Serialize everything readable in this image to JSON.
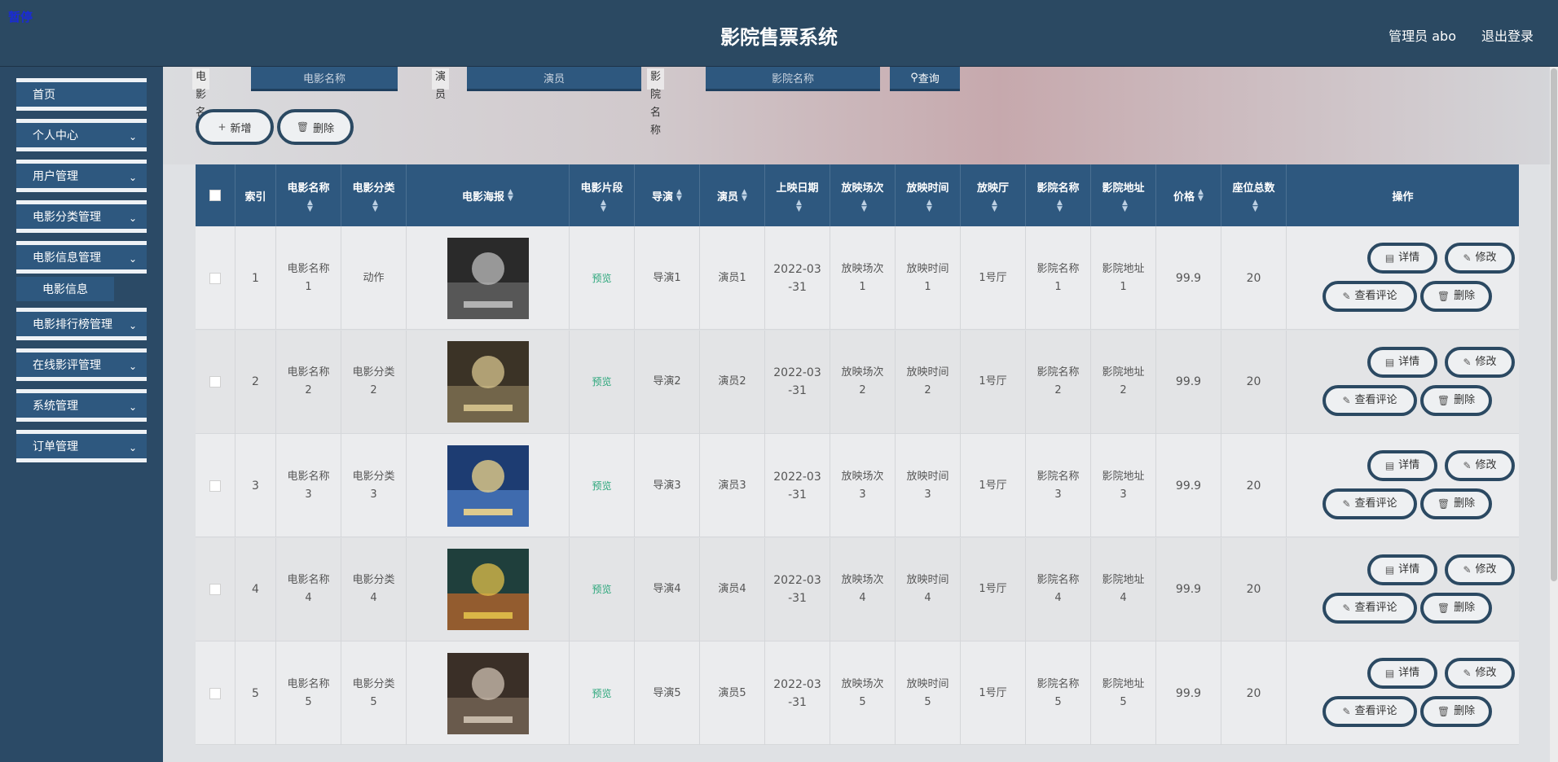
{
  "header": {
    "pause": "暂停",
    "title": "影院售票系统",
    "admin": "管理员 abo",
    "logout": "退出登录"
  },
  "sidebar": {
    "items": [
      {
        "label": "首页"
      },
      {
        "label": "个人中心"
      },
      {
        "label": "用户管理"
      },
      {
        "label": "电影分类管理"
      },
      {
        "label": "电影信息管理"
      },
      {
        "label": "电影排行榜管理"
      },
      {
        "label": "在线影评管理"
      },
      {
        "label": "系统管理"
      },
      {
        "label": "订单管理"
      }
    ],
    "sub_item": "电影信息"
  },
  "search": {
    "movie_name_label": "电影名称",
    "movie_name_placeholder": "电影名称",
    "actor_label": "演员",
    "actor_placeholder": "演员",
    "cinema_label": "影院名称",
    "cinema_placeholder": "影院名称",
    "query_button": "查询"
  },
  "toolbar": {
    "add_label": "新增",
    "delete_label": "删除"
  },
  "table": {
    "headers": {
      "index": "索引",
      "name": "电影名称",
      "category": "电影分类",
      "poster": "电影海报",
      "clip": "电影片段",
      "director": "导演",
      "actor": "演员",
      "release": "上映日期",
      "session": "放映场次",
      "showtime": "放映时间",
      "hall": "放映厅",
      "cinema": "影院名称",
      "address": "影院地址",
      "price": "价格",
      "seats": "座位总数",
      "actions": "操作"
    },
    "rows": [
      {
        "index": "1",
        "name_a": "电影名称",
        "name_b": "1",
        "cat_a": "动作",
        "cat_b": "",
        "clip": "预览",
        "director": "导演1",
        "actor": "演员1",
        "date_a": "2022-03",
        "date_b": "-31",
        "session_a": "放映场次",
        "session_b": "1",
        "time_a": "放映时间",
        "time_b": "1",
        "hall": "1号厅",
        "cinema_a": "影院名称",
        "cinema_b": "1",
        "addr_a": "影院地址",
        "addr_b": "1",
        "price": "99.9",
        "seats": "20"
      },
      {
        "index": "2",
        "name_a": "电影名称",
        "name_b": "2",
        "cat_a": "电影分类",
        "cat_b": "2",
        "clip": "预览",
        "director": "导演2",
        "actor": "演员2",
        "date_a": "2022-03",
        "date_b": "-31",
        "session_a": "放映场次",
        "session_b": "2",
        "time_a": "放映时间",
        "time_b": "2",
        "hall": "1号厅",
        "cinema_a": "影院名称",
        "cinema_b": "2",
        "addr_a": "影院地址",
        "addr_b": "2",
        "price": "99.9",
        "seats": "20"
      },
      {
        "index": "3",
        "name_a": "电影名称",
        "name_b": "3",
        "cat_a": "电影分类",
        "cat_b": "3",
        "clip": "预览",
        "director": "导演3",
        "actor": "演员3",
        "date_a": "2022-03",
        "date_b": "-31",
        "session_a": "放映场次",
        "session_b": "3",
        "time_a": "放映时间",
        "time_b": "3",
        "hall": "1号厅",
        "cinema_a": "影院名称",
        "cinema_b": "3",
        "addr_a": "影院地址",
        "addr_b": "3",
        "price": "99.9",
        "seats": "20"
      },
      {
        "index": "4",
        "name_a": "电影名称",
        "name_b": "4",
        "cat_a": "电影分类",
        "cat_b": "4",
        "clip": "预览",
        "director": "导演4",
        "actor": "演员4",
        "date_a": "2022-03",
        "date_b": "-31",
        "session_a": "放映场次",
        "session_b": "4",
        "time_a": "放映时间",
        "time_b": "4",
        "hall": "1号厅",
        "cinema_a": "影院名称",
        "cinema_b": "4",
        "addr_a": "影院地址",
        "addr_b": "4",
        "price": "99.9",
        "seats": "20"
      },
      {
        "index": "5",
        "name_a": "电影名称",
        "name_b": "5",
        "cat_a": "电影分类",
        "cat_b": "5",
        "clip": "预览",
        "director": "导演5",
        "actor": "演员5",
        "date_a": "2022-03",
        "date_b": "-31",
        "session_a": "放映场次",
        "session_b": "5",
        "time_a": "放映时间",
        "time_b": "5",
        "hall": "1号厅",
        "cinema_a": "影院名称",
        "cinema_b": "5",
        "addr_a": "影院地址",
        "addr_b": "5",
        "price": "99.9",
        "seats": "20"
      }
    ],
    "actions": {
      "detail": "详情",
      "edit": "修改",
      "review": "查看评论",
      "delete": "删除"
    }
  },
  "colors": {
    "header_bg": "#2b4962",
    "accent": "#2e587f",
    "preview_link": "#2aa67a"
  },
  "icons": {
    "search": "search-icon",
    "add": "plus-icon",
    "delete": "trash-icon",
    "detail": "document-icon",
    "edit": "pencil-icon",
    "chevron": "chevron-down-icon",
    "sort": "sort-icon"
  }
}
